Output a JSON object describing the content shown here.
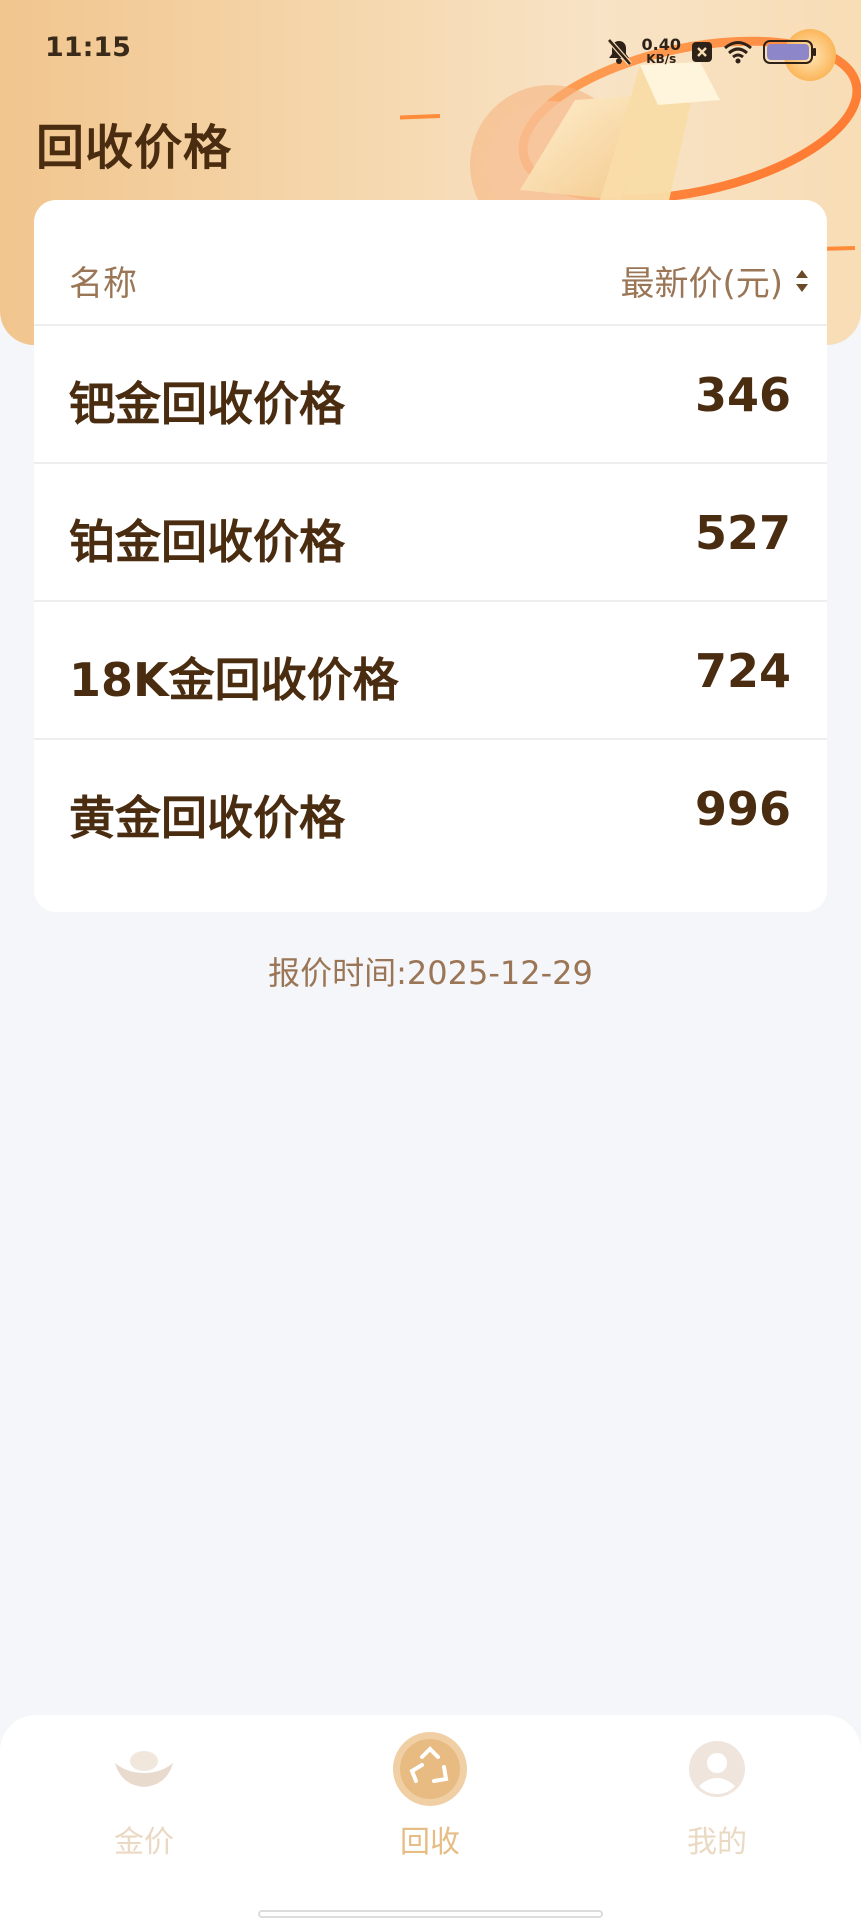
{
  "status_bar": {
    "time": "11:15",
    "net_speed_value": "0.40",
    "net_speed_unit": "KB/s",
    "icons": [
      "bell-off-icon",
      "close-box-icon",
      "wifi-icon",
      "battery-icon"
    ]
  },
  "header": {
    "title": "回收价格"
  },
  "table": {
    "col_name": "名称",
    "col_price": "最新价(元)",
    "rows": [
      {
        "name": "钯金回收价格",
        "price": "346"
      },
      {
        "name": "铂金回收价格",
        "price": "527"
      },
      {
        "name": "18K金回收价格",
        "price": "724"
      },
      {
        "name": "黄金回收价格",
        "price": "996"
      }
    ]
  },
  "quote_time": "报价时间:2025-12-29",
  "bottom_nav": {
    "items": [
      {
        "label": "金价",
        "icon": "gold-ingot-icon",
        "active": false
      },
      {
        "label": "回收",
        "icon": "recycle-icon",
        "active": true
      },
      {
        "label": "我的",
        "icon": "user-icon",
        "active": false
      }
    ]
  },
  "colors": {
    "accent": "#e6bd86",
    "text_primary": "#4a2d10",
    "text_secondary": "#9a7656",
    "background": "#f4f6fa"
  }
}
